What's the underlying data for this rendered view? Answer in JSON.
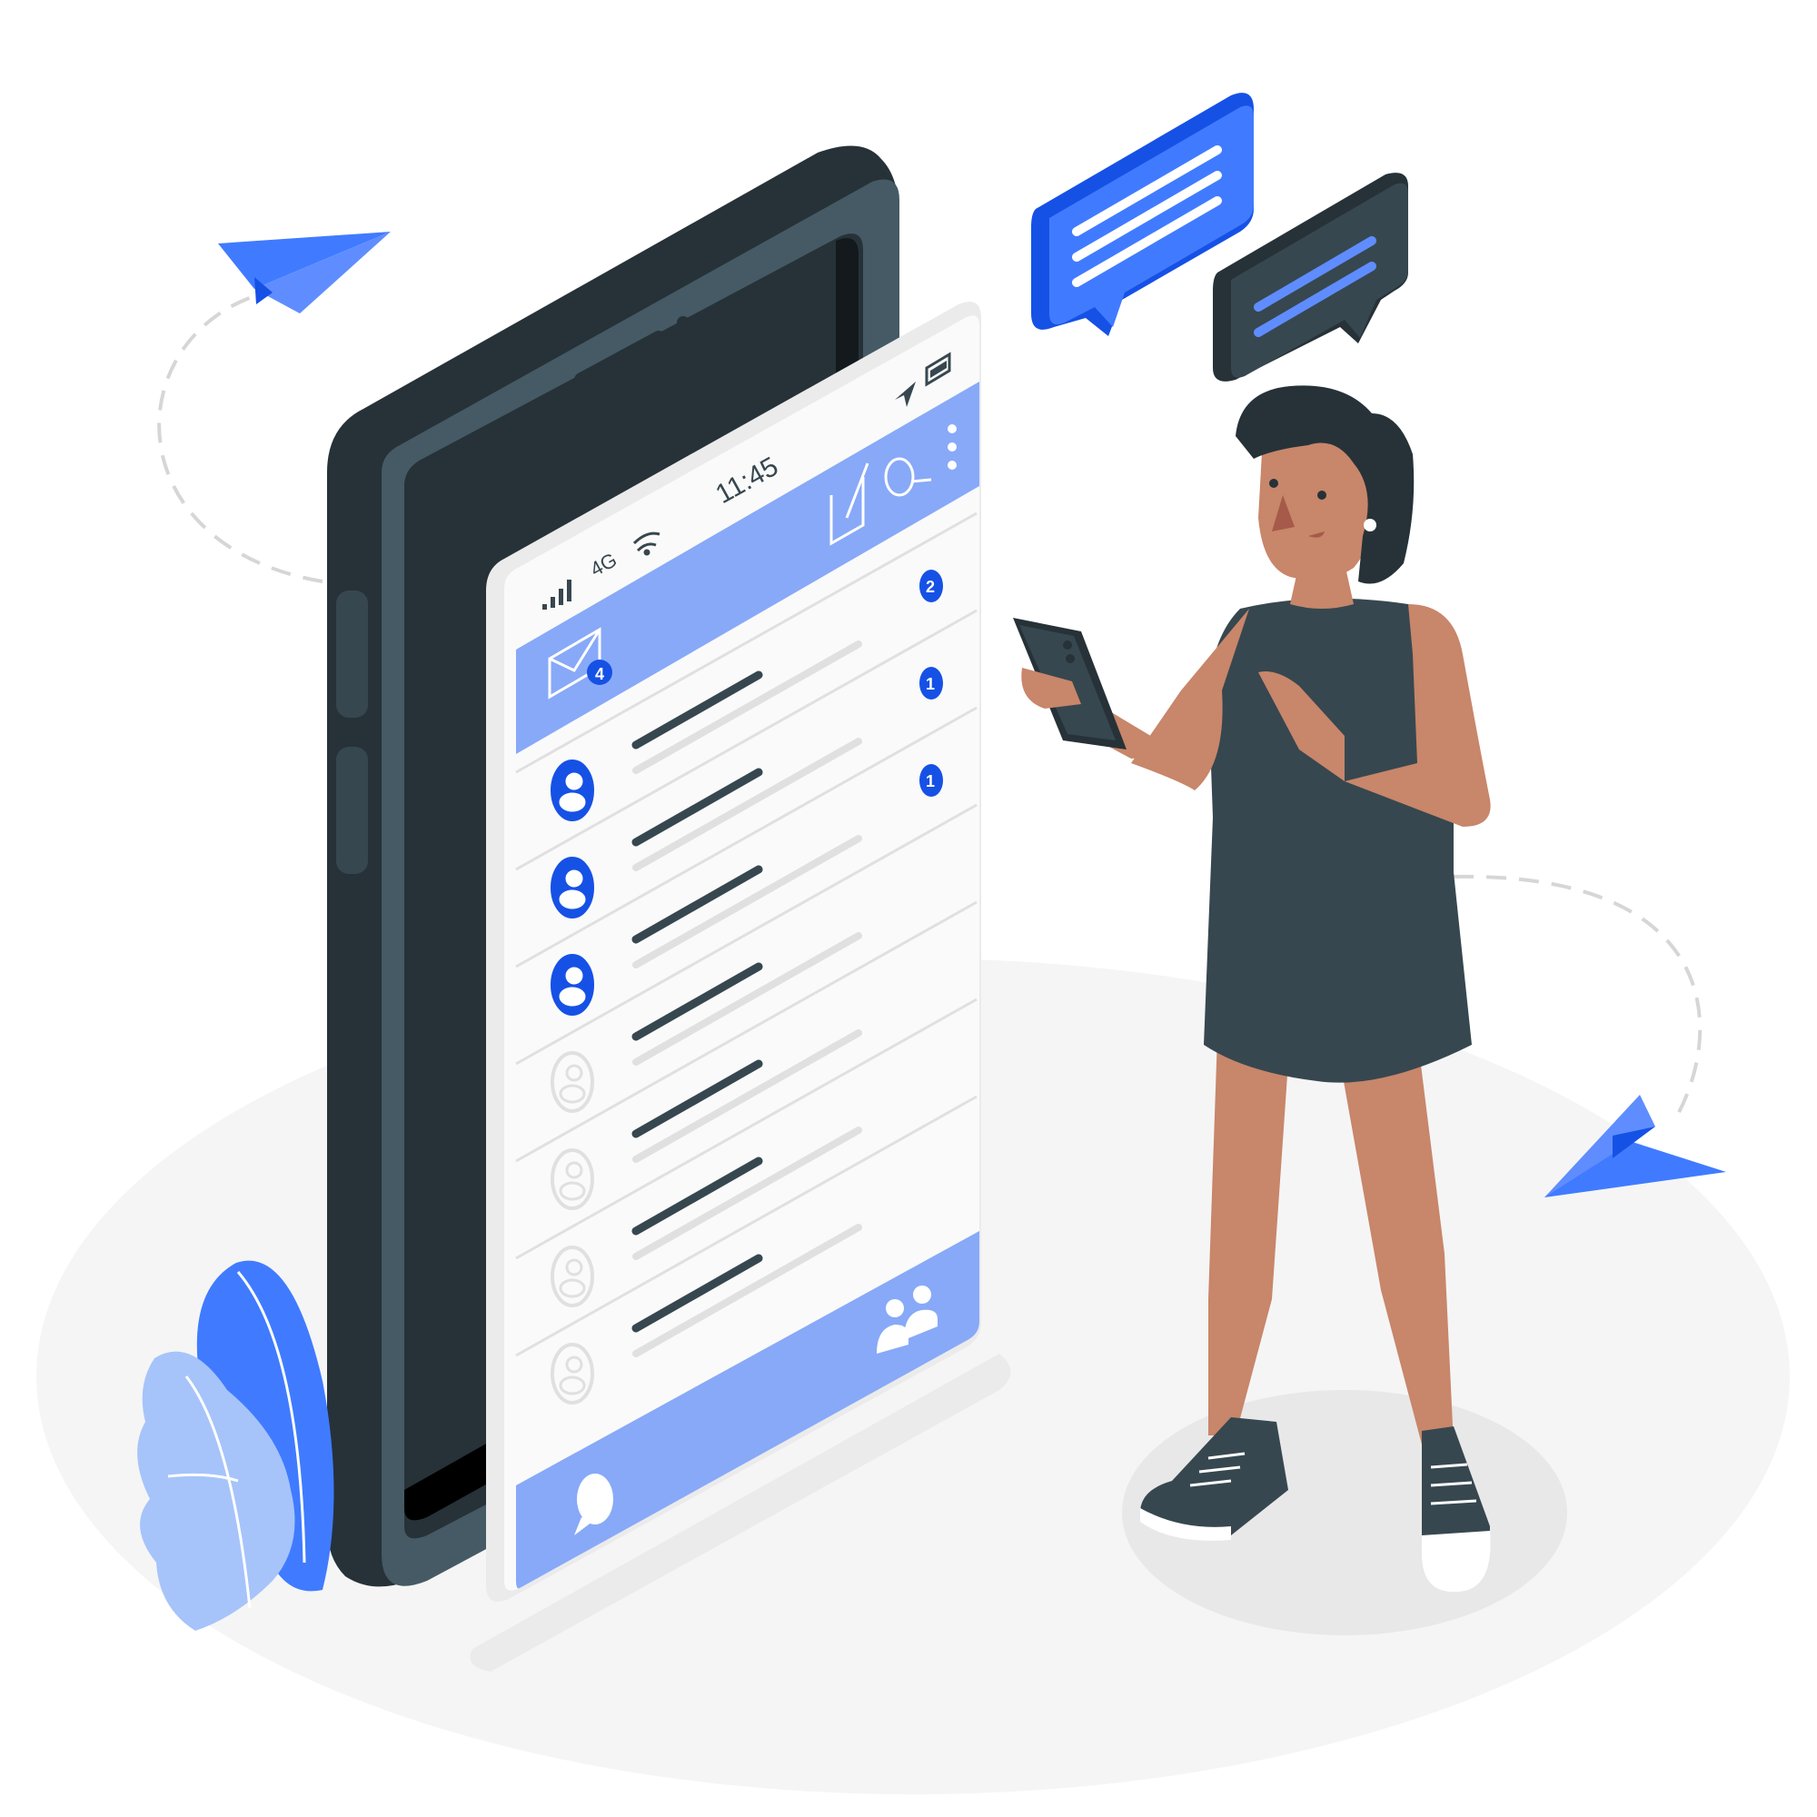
{
  "colors": {
    "accent": "#407bff",
    "accent_light": "#88a9f8",
    "dark": "#37474f",
    "darker": "#263238",
    "screen": "#f5f5f5",
    "muted": "#e0e0e0",
    "skin": "#c8866a",
    "badge": "#1651e6"
  },
  "status_bar": {
    "network": "4G",
    "time": "11:45",
    "icons": [
      "signal-icon",
      "wifi-icon",
      "location-arrow-icon",
      "battery-icon"
    ]
  },
  "header": {
    "mail_badge": "4",
    "icons": [
      "mail-icon",
      "compose-icon",
      "search-icon",
      "more-vertical-icon"
    ]
  },
  "conversations": [
    {
      "avatar": "user-icon",
      "active": true,
      "unread": "2"
    },
    {
      "avatar": "user-icon",
      "active": true,
      "unread": "1"
    },
    {
      "avatar": "user-icon",
      "active": true,
      "unread": "1"
    },
    {
      "avatar": "user-icon",
      "active": false,
      "unread": ""
    },
    {
      "avatar": "user-icon",
      "active": false,
      "unread": ""
    },
    {
      "avatar": "user-icon",
      "active": false,
      "unread": ""
    },
    {
      "avatar": "user-icon",
      "active": false,
      "unread": ""
    }
  ],
  "bottom_bar": {
    "icons": [
      "chat-bubble-icon",
      "contacts-icon"
    ]
  },
  "decorations": [
    "paper-plane-icon",
    "paper-plane-icon",
    "speech-bubble-icon",
    "speech-bubble-icon",
    "leaf-icon",
    "person-with-phone"
  ]
}
